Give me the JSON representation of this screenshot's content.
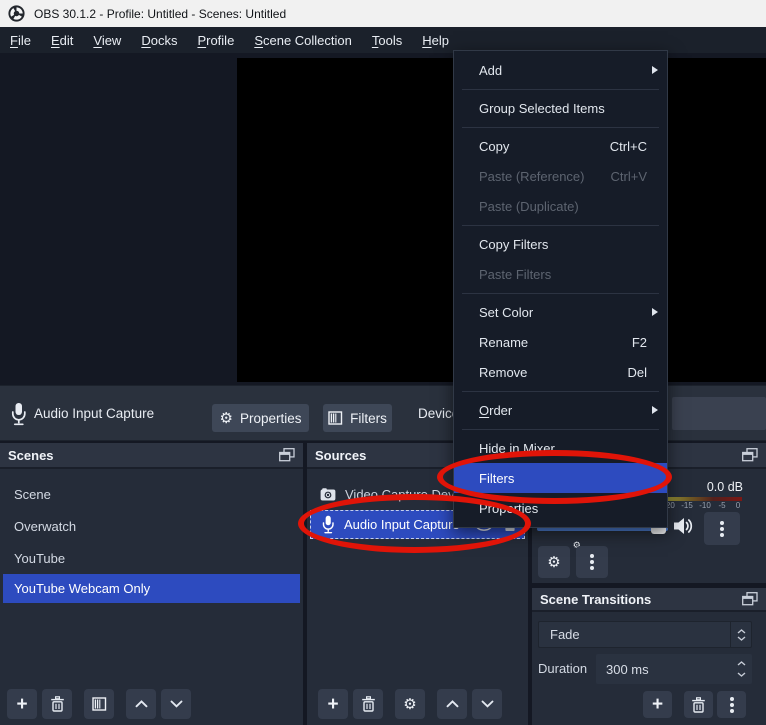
{
  "titlebar": {
    "title": "OBS 30.1.2 - Profile: Untitled - Scenes: Untitled"
  },
  "menubar": {
    "items": [
      {
        "first": "F",
        "rest": "ile"
      },
      {
        "first": "E",
        "rest": "dit"
      },
      {
        "first": "V",
        "rest": "iew"
      },
      {
        "first": "D",
        "rest": "ocks"
      },
      {
        "first": "P",
        "rest": "rofile"
      },
      {
        "first": "S",
        "rest": "cene Collection"
      },
      {
        "first": "T",
        "rest": "ools"
      },
      {
        "first": "H",
        "rest": "elp"
      }
    ]
  },
  "source_toolbar": {
    "source_name": "Audio Input Capture",
    "properties_label": "Properties",
    "filters_label": "Filters",
    "device_label": "Device"
  },
  "context_menu": {
    "items": [
      {
        "label": "Add",
        "submenu": true
      },
      {
        "label": "Group Selected Items"
      },
      {
        "label": "Copy",
        "shortcut": "Ctrl+C"
      },
      {
        "label": "Paste (Reference)",
        "shortcut": "Ctrl+V",
        "disabled": true
      },
      {
        "label": "Paste (Duplicate)",
        "disabled": true
      },
      {
        "label": "Copy Filters"
      },
      {
        "label": "Paste Filters",
        "disabled": true
      },
      {
        "label": "Set Color",
        "submenu": true
      },
      {
        "label": "Rename",
        "shortcut": "F2"
      },
      {
        "label": "Remove",
        "shortcut": "Del"
      },
      {
        "label": "Order",
        "mnemonic_first": "O",
        "mnemonic_rest": "rder",
        "submenu": true
      },
      {
        "label": "Hide in Mixer"
      },
      {
        "label": "Filters",
        "highlighted": true
      },
      {
        "label": "Properties"
      }
    ]
  },
  "scenes_panel": {
    "title": "Scenes",
    "items": [
      "Scene",
      "Overwatch",
      "YouTube",
      "YouTube Webcam Only"
    ],
    "selected": "YouTube Webcam Only"
  },
  "sources_panel": {
    "title": "Sources",
    "items": [
      "Video Capture Device",
      "Audio Input Capture"
    ],
    "selected": "Audio Input Capture"
  },
  "mixer_panel": {
    "level_label": "0.0 dB",
    "scale_ticks": [
      "-20",
      "-15",
      "-10",
      "-5",
      "0"
    ]
  },
  "transitions_panel": {
    "title": "Scene Transitions",
    "selected_transition": "Fade",
    "duration_label": "Duration",
    "duration_value": "300 ms"
  },
  "glyphs": {
    "gear": "⚙",
    "plus": "+"
  },
  "colors": {
    "selection_blue": "#2d4bbf",
    "annotation_red": "#e01408"
  }
}
